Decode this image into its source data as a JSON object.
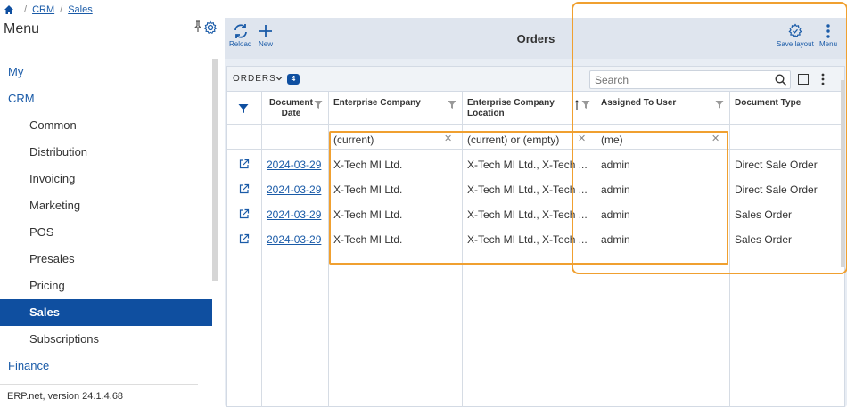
{
  "breadcrumb": {
    "items": [
      "CRM",
      "Sales"
    ]
  },
  "sidebar": {
    "title": "Menu",
    "items": [
      {
        "label": "My",
        "level": 0,
        "active": false
      },
      {
        "label": "CRM",
        "level": 0,
        "active": false
      },
      {
        "label": "Common",
        "level": 1,
        "active": false
      },
      {
        "label": "Distribution",
        "level": 1,
        "active": false
      },
      {
        "label": "Invoicing",
        "level": 1,
        "active": false
      },
      {
        "label": "Marketing",
        "level": 1,
        "active": false
      },
      {
        "label": "POS",
        "level": 1,
        "active": false
      },
      {
        "label": "Presales",
        "level": 1,
        "active": false
      },
      {
        "label": "Pricing",
        "level": 1,
        "active": false
      },
      {
        "label": "Sales",
        "level": 1,
        "active": true
      },
      {
        "label": "Subscriptions",
        "level": 1,
        "active": false
      },
      {
        "label": "Finance",
        "level": 0,
        "active": false
      }
    ],
    "footer": "ERP.net, version 24.1.4.68"
  },
  "toolbar": {
    "reload_label": "Reload",
    "new_label": "New",
    "title": "Orders",
    "save_layout_label": "Save layout",
    "menu_label": "Menu"
  },
  "grid": {
    "label": "ORDERS",
    "count": "4",
    "search_placeholder": "Search",
    "columns": {
      "document_date": "Document Date",
      "enterprise_company": "Enterprise Company",
      "enterprise_company_location": "Enterprise Company Location",
      "assigned_to_user": "Assigned To User",
      "document_type": "Document Type"
    },
    "filters": {
      "enterprise_company": "(current)",
      "enterprise_company_location": "(current) or (empty)",
      "assigned_to_user": "(me)"
    },
    "rows": [
      {
        "date": "2024-03-29",
        "company": "X-Tech MI Ltd.",
        "location": "X-Tech MI Ltd., X-Tech ...",
        "user": "admin",
        "type": "Direct Sale Order"
      },
      {
        "date": "2024-03-29",
        "company": "X-Tech MI Ltd.",
        "location": "X-Tech MI Ltd., X-Tech ...",
        "user": "admin",
        "type": "Direct Sale Order"
      },
      {
        "date": "2024-03-29",
        "company": "X-Tech MI Ltd.",
        "location": "X-Tech MI Ltd., X-Tech ...",
        "user": "admin",
        "type": "Sales Order"
      },
      {
        "date": "2024-03-29",
        "company": "X-Tech MI Ltd.",
        "location": "X-Tech MI Ltd., X-Tech ...",
        "user": "admin",
        "type": "Sales Order"
      }
    ]
  },
  "colors": {
    "accent": "#0f4fa0",
    "highlight": "#f0a030",
    "link": "#1a5ba8"
  }
}
